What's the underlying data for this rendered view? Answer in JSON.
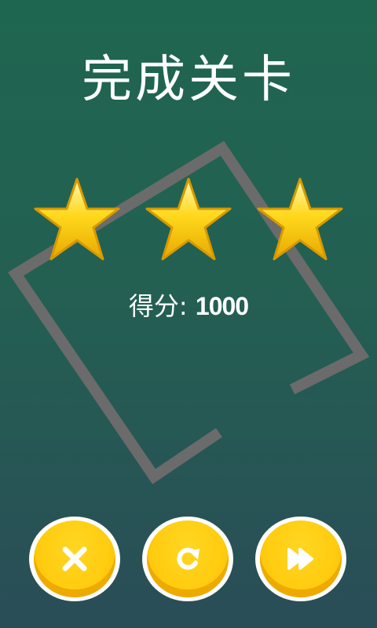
{
  "screen": {
    "title": "完成关卡",
    "score_label": "得分: ",
    "score_value": "1000",
    "stars_earned": 3,
    "stars_total": 3
  },
  "colors": {
    "background_top": "#1f6650",
    "background_bottom": "#2a4d57",
    "star_gold": "#ffd21a",
    "button_yellow": "#ffcc10",
    "frame_gray": "#6b6b6b"
  },
  "buttons": [
    {
      "name": "close-button",
      "icon": "close-icon"
    },
    {
      "name": "replay-button",
      "icon": "replay-icon"
    },
    {
      "name": "next-level-button",
      "icon": "fast-forward-icon"
    }
  ]
}
